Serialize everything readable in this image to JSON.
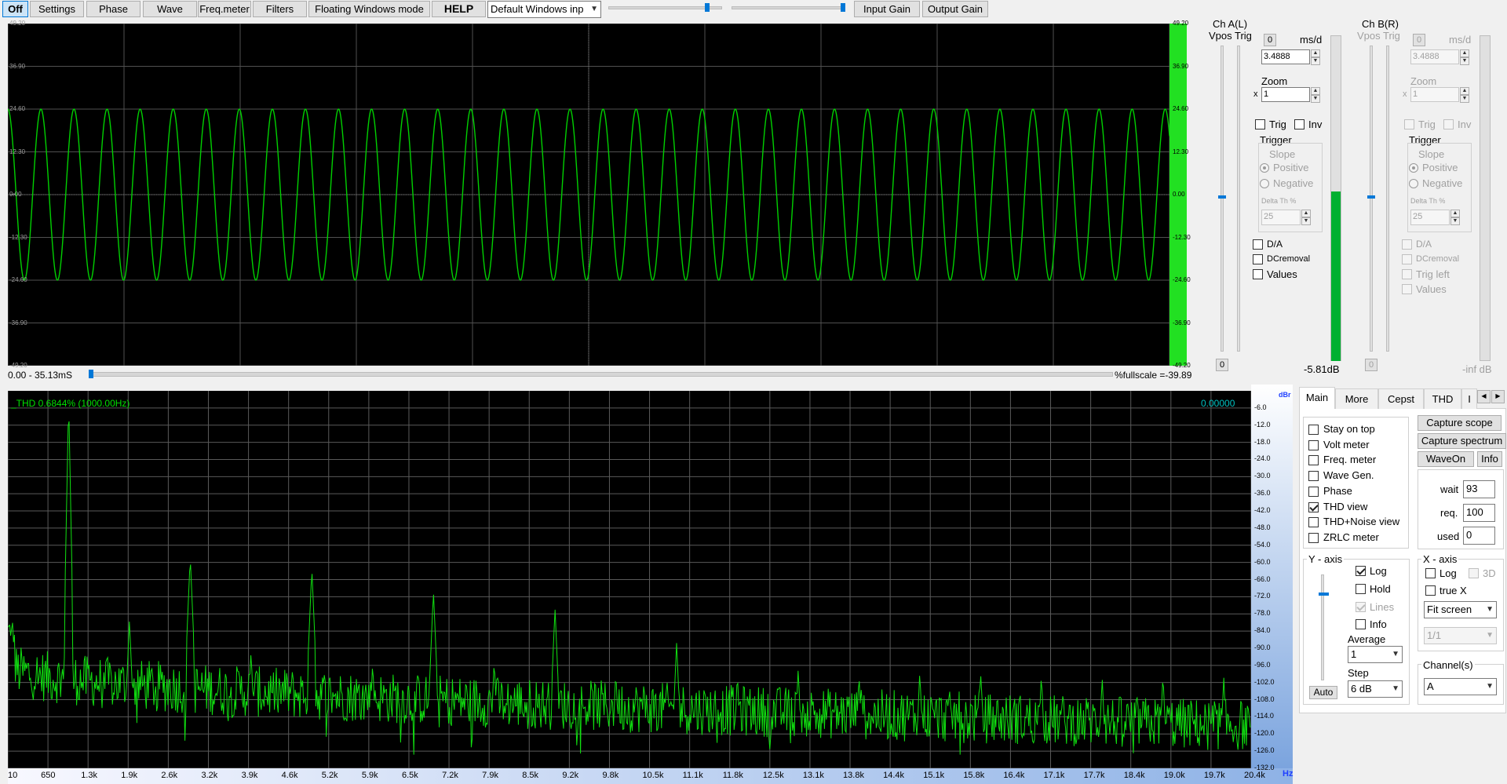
{
  "toolbar": {
    "off": "Off",
    "settings": "Settings",
    "phase": "Phase",
    "wave": "Wave",
    "freq_meter": "Freq.meter",
    "filters": "Filters",
    "floating": "Floating Windows mode",
    "help": "HELP",
    "windows_combo": "Default Windows inp",
    "input_gain": "Input Gain",
    "output_gain": "Output Gain",
    "slider1_level": 0.87,
    "slider2_level": 0.98
  },
  "scope": {
    "trace_color": "#00d000",
    "meter_color": "#22e022",
    "y_ticks": [
      "49.20",
      "36.90",
      "24.60",
      "12.30",
      "0.00",
      "-12.30",
      "-24.60",
      "-36.90",
      "-49.20"
    ],
    "time_range": "0.00 - 35.13mS",
    "fullscale": "%fullscale =-39.89",
    "cycles": 35.13,
    "amplitude": 24.6
  },
  "ch_a": {
    "title": "Ch A(L)",
    "vpos_trig": "Vpos Trig",
    "zero_btn": "0",
    "ms_d": "ms/d",
    "ms_value": "3.4888",
    "zoom_label": "Zoom",
    "zoom_x": "x",
    "zoom_value": "1",
    "trig": "Trig",
    "inv": "Inv",
    "trigger": "Trigger",
    "slope": "Slope",
    "positive": "Positive",
    "negative": "Negative",
    "delta": "Delta Th %",
    "delta_value": "25",
    "da": "D/A",
    "dcremoval": "DCremoval",
    "values": "Values",
    "bottom_zero": "0",
    "db": "-5.81dB",
    "level": 0.52
  },
  "ch_b": {
    "title": "Ch B(R)",
    "vpos_trig": "Vpos Trig",
    "zero_btn": "0",
    "ms_d": "ms/d",
    "ms_value": "3.4888",
    "zoom_label": "Zoom",
    "zoom_x": "x",
    "zoom_value": "1",
    "trig": "Trig",
    "inv": "Inv",
    "trigger": "Trigger",
    "slope": "Slope",
    "positive": "Positive",
    "negative": "Negative",
    "delta": "Delta Th %",
    "delta_value": "25",
    "da": "D/A",
    "dcremoval": "DCremoval",
    "trig_left": "Trig left",
    "values": "Values",
    "bottom_zero": "0",
    "db": "-inf dB"
  },
  "spectrum": {
    "thd": "_THD 0.6844% (1000.00Hz)",
    "readout": "0.00000",
    "trace_color": "#10e010",
    "db_unit": "dBr",
    "hz_unit": "Hz",
    "y_ticks": [
      "-6.0",
      "-12.0",
      "-18.0",
      "-24.0",
      "-30.0",
      "-36.0",
      "-42.0",
      "-48.0",
      "-54.0",
      "-60.0",
      "-66.0",
      "-72.0",
      "-78.0",
      "-84.0",
      "-90.0",
      "-96.0",
      "-102.0",
      "-108.0",
      "-114.0",
      "-120.0",
      "-126.0",
      "-132.0"
    ],
    "x_ticks": [
      "10",
      "650",
      "1.3k",
      "1.9k",
      "2.6k",
      "3.2k",
      "3.9k",
      "4.6k",
      "5.2k",
      "5.9k",
      "6.5k",
      "7.2k",
      "7.9k",
      "8.5k",
      "9.2k",
      "9.8k",
      "10.5k",
      "11.1k",
      "11.8k",
      "12.5k",
      "13.1k",
      "13.8k",
      "14.4k",
      "15.1k",
      "15.8k",
      "16.4k",
      "17.1k",
      "17.7k",
      "18.4k",
      "19.0k",
      "19.7k",
      "20.4k"
    ],
    "ymax": 0,
    "ymin": -132,
    "xmax_hz": 20450,
    "fundamental_hz": 1000,
    "harmonics_db": [
      -3,
      -80,
      -58,
      -91,
      -62,
      -95,
      -70,
      -94,
      -76,
      -98,
      -88,
      -99,
      -97,
      -99,
      -98,
      -98,
      -99,
      -100,
      -99,
      -100
    ]
  },
  "tabs": [
    "Main",
    "More",
    "Cepst",
    "THD",
    "I"
  ],
  "main_panel": {
    "stay_on_top": "Stay on top",
    "volt_meter": "Volt meter",
    "freq_meter": "Freq. meter",
    "wave_gen": "Wave Gen.",
    "phase": "Phase",
    "thd_view": "THD view",
    "thd_noise_view": "THD+Noise view",
    "zrlc_meter": "ZRLC meter",
    "capture_scope": "Capture scope",
    "capture_spectrum": "Capture spectrum",
    "wave_on": "WaveOn",
    "info": "Info",
    "wait_label": "wait",
    "wait_value": "93",
    "req_label": "req.",
    "req_value": "100",
    "used_label": "used",
    "used_value": "0",
    "y_axis": "Y - axis",
    "log": "Log",
    "hold": "Hold",
    "lines": "Lines",
    "info_cb": "Info",
    "average": "Average",
    "average_value": "1",
    "step": "Step",
    "step_value": "6 dB",
    "auto": "Auto",
    "x_axis": "X - axis",
    "x_log": "Log",
    "three_d": "3D",
    "true_x": "true X",
    "fit": "Fit screen",
    "ratio": "1/1",
    "channels": "Channel(s)",
    "channel_value": "A"
  }
}
